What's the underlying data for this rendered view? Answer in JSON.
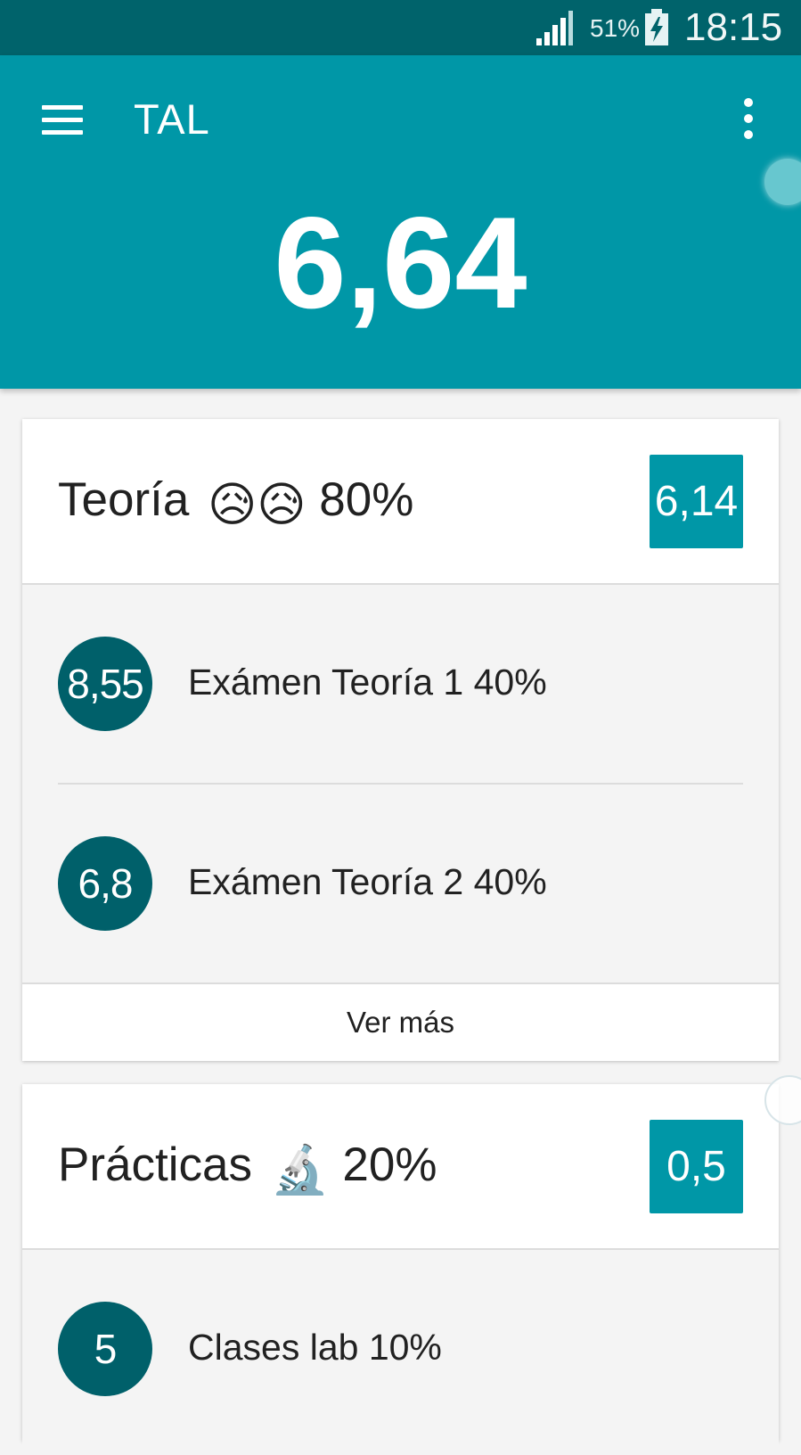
{
  "status_bar": {
    "battery_percent": "51%",
    "time": "18:15",
    "signal_icon": "signal-bars-icon",
    "battery_icon": "battery-charging-icon"
  },
  "app_bar": {
    "title": "TAL",
    "menu_icon": "hamburger-menu-icon",
    "more_icon": "more-vert-icon",
    "overall_grade": "6,64"
  },
  "colors": {
    "primary": "#0097a7",
    "primary_dark": "#00636b",
    "circle": "#00606a",
    "background": "#f4f4f4"
  },
  "sections": [
    {
      "title": "Teoría",
      "emoji": "😥😥",
      "weight": "80%",
      "grade": "6,14",
      "items": [
        {
          "grade": "8,55",
          "label": "Exámen Teoría 1 40%"
        },
        {
          "grade": "6,8",
          "label": "Exámen Teoría 2 40%"
        }
      ],
      "footer_label": "Ver más"
    },
    {
      "title": "Prácticas",
      "emoji": "🔬",
      "weight": "20%",
      "grade": "0,5",
      "items": [
        {
          "grade": "5",
          "label": "Clases lab 10%"
        }
      ]
    }
  ]
}
